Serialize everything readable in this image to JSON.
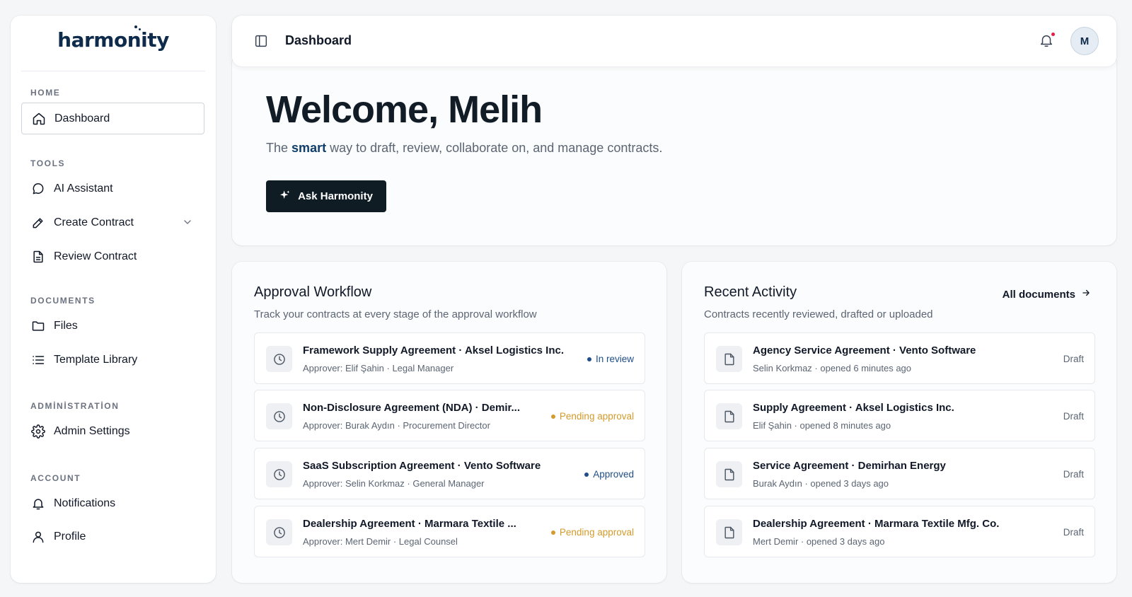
{
  "brand": {
    "logo_text": "harmonity"
  },
  "sidebar": {
    "sections": [
      {
        "label": "HOME"
      },
      {
        "label": "TOOLS"
      },
      {
        "label": "DOCUMENTS"
      },
      {
        "label": "ADMİNİSTRATİON"
      },
      {
        "label": "ACCOUNT"
      }
    ],
    "items": [
      {
        "label": "Dashboard",
        "icon": "home-icon",
        "active": true
      },
      {
        "label": "AI Assistant",
        "icon": "chat-icon"
      },
      {
        "label": "Create Contract",
        "icon": "pen-icon",
        "expandable": true
      },
      {
        "label": "Review Contract",
        "icon": "document-icon"
      },
      {
        "label": "Files",
        "icon": "folder-icon"
      },
      {
        "label": "Template Library",
        "icon": "list-icon"
      },
      {
        "label": "Admin Settings",
        "icon": "gear-icon"
      },
      {
        "label": "Notifications",
        "icon": "bell-icon"
      },
      {
        "label": "Profile",
        "icon": "user-icon"
      }
    ]
  },
  "header": {
    "title": "Dashboard",
    "avatar_initial": "M",
    "has_unread_notifications": true
  },
  "welcome": {
    "title": "Welcome, Melih",
    "subtitle_prefix": "The",
    "subtitle_highlight": "smart",
    "subtitle_suffix": "way to draft, review, collaborate on, and manage contracts.",
    "cta_label": "Ask Harmonity"
  },
  "approval": {
    "title": "Approval Workflow",
    "subtitle": "Track your contracts at every stage of the approval workflow",
    "rows": [
      {
        "title": "Framework Supply Agreement · Aksel Logistics Inc.",
        "meta": "Approver: Elif Şahin · Legal Manager",
        "status": "In review",
        "status_type": "review"
      },
      {
        "title": "Non-Disclosure Agreement (NDA) · Demir...",
        "meta": "Approver: Burak Aydın · Procurement Director",
        "status": "Pending approval",
        "status_type": "pending"
      },
      {
        "title": "SaaS Subscription Agreement · Vento Software",
        "meta": "Approver: Selin Korkmaz · General Manager",
        "status": "Approved",
        "status_type": "approved"
      },
      {
        "title": "Dealership Agreement · Marmara Textile ...",
        "meta": "Approver: Mert Demir · Legal Counsel",
        "status": "Pending approval",
        "status_type": "pending"
      }
    ]
  },
  "activity": {
    "title": "Recent Activity",
    "subtitle": "Contracts recently reviewed, drafted or uploaded",
    "link_label": "All documents",
    "rows": [
      {
        "title": "Agency Service Agreement · Vento Software",
        "meta": "Selin Korkmaz · opened 6 minutes ago",
        "status": "Draft"
      },
      {
        "title": "Supply Agreement · Aksel Logistics Inc.",
        "meta": "Elif Şahin · opened 8 minutes ago",
        "status": "Draft"
      },
      {
        "title": "Service Agreement · Demirhan Energy",
        "meta": "Burak Aydın · opened 3 days ago",
        "status": "Draft"
      },
      {
        "title": "Dealership Agreement · Marmara Textile Mfg. Co.",
        "meta": "Mert Demir · opened 3 days ago",
        "status": "Draft"
      }
    ]
  },
  "colors": {
    "brand": "#0f2b4c",
    "accent_highlight": "#0f3e6b",
    "cta_bg": "#0f1c24",
    "status_review": "#1f4e86",
    "status_pending": "#d49a2a",
    "notification_dot": "#e11d48"
  }
}
